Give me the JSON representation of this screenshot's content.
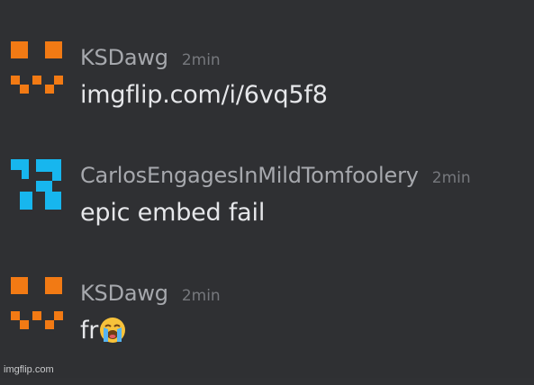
{
  "messages": [
    {
      "username": "KSDawg",
      "time": "2min",
      "text": "imgflip.com/i/6vq5f8",
      "avatar": {
        "icon": "orange-pixel-face-icon",
        "color": "#f27a14"
      }
    },
    {
      "username": "CarlosEngagesInMildTomfoolery",
      "time": "2min",
      "text": "epic embed fail",
      "avatar": {
        "icon": "blue-pixel-face-icon",
        "color": "#17b6ee"
      }
    },
    {
      "username": "KSDawg",
      "time": "2min",
      "text": "fr",
      "emoji": "loudly-crying-face-icon",
      "avatar": {
        "icon": "orange-pixel-face-icon",
        "color": "#f27a14"
      }
    }
  ],
  "watermark": "imgflip.com"
}
